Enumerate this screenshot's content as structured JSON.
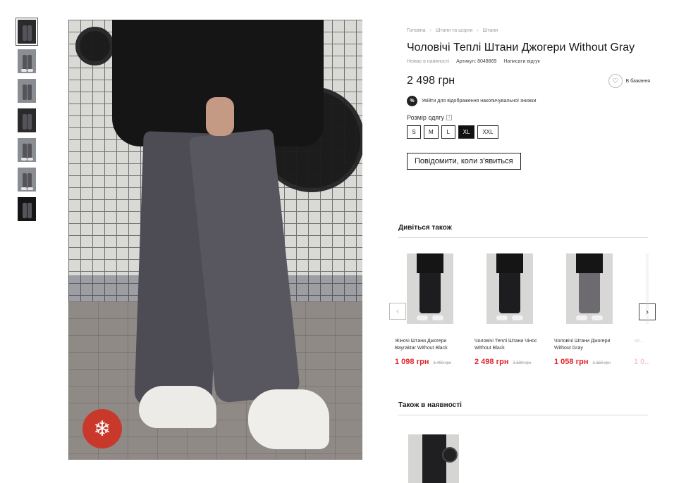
{
  "gallery": {
    "thumbnails": [
      "thumb-1",
      "thumb-2",
      "thumb-3",
      "thumb-4",
      "thumb-5",
      "thumb-6",
      "thumb-7"
    ],
    "active_index": 0,
    "badge_icon": "snowflake-icon"
  },
  "breadcrumb": {
    "items": [
      "Головна",
      "Штани та шорти",
      "Штани"
    ]
  },
  "product": {
    "title": "Чоловічі Теплі Штани Джогери Without Gray",
    "availability": "Немає в наявності",
    "article": "Артикул: 8048869",
    "review_link": "Написати відгук",
    "price": "2 498 грн",
    "wishlist_label": "В бажання",
    "discount_note": "Увійти для відображення накопичувальної знижки",
    "discount_badge": "%",
    "size_label": "Розмір одягу",
    "sizes": [
      "S",
      "M",
      "L",
      "XL",
      "XXL"
    ],
    "selected_size": "XL",
    "notify_button": "Повідомити, коли з'явиться"
  },
  "see_also": {
    "title": "Дивіться також",
    "cards": [
      {
        "name": "Жіночі Штани Джогери Bayraktar Without Black",
        "price": "1 098 грн",
        "old_price": "1 490 грн"
      },
      {
        "name": "Чоловічі Теплі Штани Чінос Without Black",
        "price": "2 498 грн",
        "old_price": "2 590 грн"
      },
      {
        "name": "Чоловічі Штани Джогери Without Gray",
        "price": "1 058 грн",
        "old_price": "1 150 грн"
      },
      {
        "name": "Чо...",
        "price": "1 0..."
      }
    ]
  },
  "in_stock": {
    "title": "Також в наявності"
  },
  "colors": {
    "sale_price": "#e0262b",
    "badge_red": "#c9392b",
    "selected_size_bg": "#111111"
  }
}
